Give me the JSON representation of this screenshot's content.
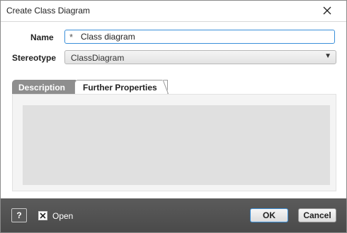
{
  "dialog": {
    "title": "Create Class Diagram"
  },
  "form": {
    "name_label": "Name",
    "name_required_mark": "*",
    "name_value": "Class diagram",
    "stereotype_label": "Stereotype",
    "stereotype_value": "ClassDiagram",
    "stereotype_arrow": "▼"
  },
  "tabs": [
    {
      "label": "Description",
      "active": true
    },
    {
      "label": "Further Properties",
      "active": false
    }
  ],
  "footer": {
    "help_label": "?",
    "open_label": "Open",
    "open_checked": true,
    "ok_label": "OK",
    "cancel_label": "Cancel"
  },
  "colors": {
    "footer_bg": "#4f4f4f",
    "active_tab_bg": "#8e8e8e",
    "focus_border": "#3a8fd9",
    "description_bg": "#e0e0e0"
  }
}
